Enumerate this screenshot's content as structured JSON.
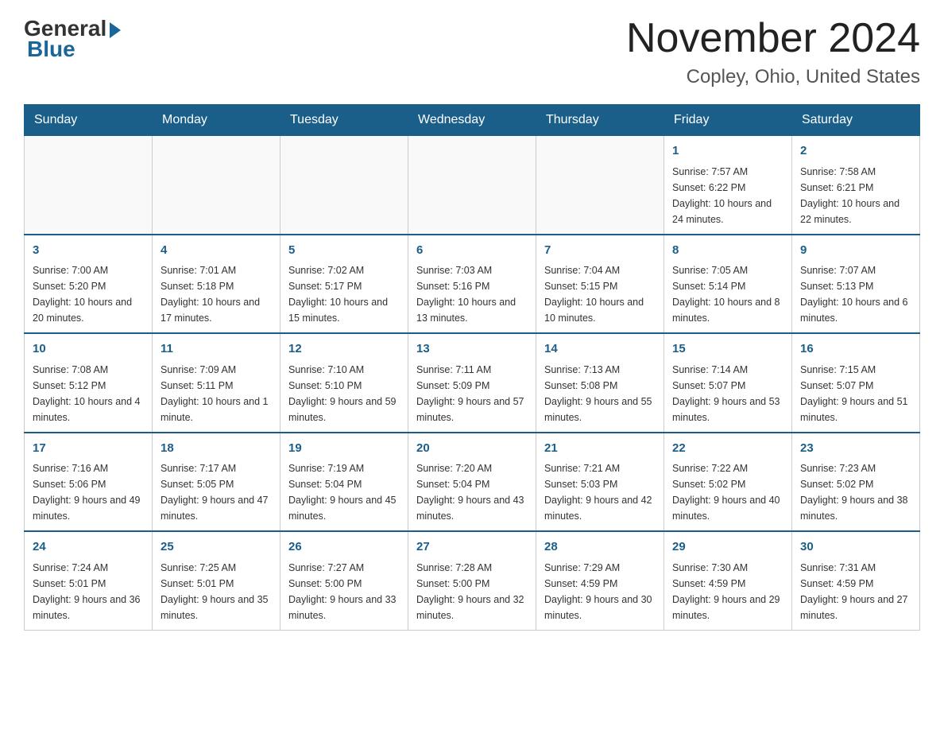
{
  "header": {
    "logo": {
      "general": "General",
      "blue": "Blue"
    },
    "title": "November 2024",
    "subtitle": "Copley, Ohio, United States"
  },
  "days_of_week": [
    "Sunday",
    "Monday",
    "Tuesday",
    "Wednesday",
    "Thursday",
    "Friday",
    "Saturday"
  ],
  "weeks": [
    {
      "cells": [
        {
          "empty": true
        },
        {
          "empty": true
        },
        {
          "empty": true
        },
        {
          "empty": true
        },
        {
          "empty": true
        },
        {
          "day": "1",
          "sunrise": "Sunrise: 7:57 AM",
          "sunset": "Sunset: 6:22 PM",
          "daylight": "Daylight: 10 hours and 24 minutes."
        },
        {
          "day": "2",
          "sunrise": "Sunrise: 7:58 AM",
          "sunset": "Sunset: 6:21 PM",
          "daylight": "Daylight: 10 hours and 22 minutes."
        }
      ]
    },
    {
      "cells": [
        {
          "day": "3",
          "sunrise": "Sunrise: 7:00 AM",
          "sunset": "Sunset: 5:20 PM",
          "daylight": "Daylight: 10 hours and 20 minutes."
        },
        {
          "day": "4",
          "sunrise": "Sunrise: 7:01 AM",
          "sunset": "Sunset: 5:18 PM",
          "daylight": "Daylight: 10 hours and 17 minutes."
        },
        {
          "day": "5",
          "sunrise": "Sunrise: 7:02 AM",
          "sunset": "Sunset: 5:17 PM",
          "daylight": "Daylight: 10 hours and 15 minutes."
        },
        {
          "day": "6",
          "sunrise": "Sunrise: 7:03 AM",
          "sunset": "Sunset: 5:16 PM",
          "daylight": "Daylight: 10 hours and 13 minutes."
        },
        {
          "day": "7",
          "sunrise": "Sunrise: 7:04 AM",
          "sunset": "Sunset: 5:15 PM",
          "daylight": "Daylight: 10 hours and 10 minutes."
        },
        {
          "day": "8",
          "sunrise": "Sunrise: 7:05 AM",
          "sunset": "Sunset: 5:14 PM",
          "daylight": "Daylight: 10 hours and 8 minutes."
        },
        {
          "day": "9",
          "sunrise": "Sunrise: 7:07 AM",
          "sunset": "Sunset: 5:13 PM",
          "daylight": "Daylight: 10 hours and 6 minutes."
        }
      ]
    },
    {
      "cells": [
        {
          "day": "10",
          "sunrise": "Sunrise: 7:08 AM",
          "sunset": "Sunset: 5:12 PM",
          "daylight": "Daylight: 10 hours and 4 minutes."
        },
        {
          "day": "11",
          "sunrise": "Sunrise: 7:09 AM",
          "sunset": "Sunset: 5:11 PM",
          "daylight": "Daylight: 10 hours and 1 minute."
        },
        {
          "day": "12",
          "sunrise": "Sunrise: 7:10 AM",
          "sunset": "Sunset: 5:10 PM",
          "daylight": "Daylight: 9 hours and 59 minutes."
        },
        {
          "day": "13",
          "sunrise": "Sunrise: 7:11 AM",
          "sunset": "Sunset: 5:09 PM",
          "daylight": "Daylight: 9 hours and 57 minutes."
        },
        {
          "day": "14",
          "sunrise": "Sunrise: 7:13 AM",
          "sunset": "Sunset: 5:08 PM",
          "daylight": "Daylight: 9 hours and 55 minutes."
        },
        {
          "day": "15",
          "sunrise": "Sunrise: 7:14 AM",
          "sunset": "Sunset: 5:07 PM",
          "daylight": "Daylight: 9 hours and 53 minutes."
        },
        {
          "day": "16",
          "sunrise": "Sunrise: 7:15 AM",
          "sunset": "Sunset: 5:07 PM",
          "daylight": "Daylight: 9 hours and 51 minutes."
        }
      ]
    },
    {
      "cells": [
        {
          "day": "17",
          "sunrise": "Sunrise: 7:16 AM",
          "sunset": "Sunset: 5:06 PM",
          "daylight": "Daylight: 9 hours and 49 minutes."
        },
        {
          "day": "18",
          "sunrise": "Sunrise: 7:17 AM",
          "sunset": "Sunset: 5:05 PM",
          "daylight": "Daylight: 9 hours and 47 minutes."
        },
        {
          "day": "19",
          "sunrise": "Sunrise: 7:19 AM",
          "sunset": "Sunset: 5:04 PM",
          "daylight": "Daylight: 9 hours and 45 minutes."
        },
        {
          "day": "20",
          "sunrise": "Sunrise: 7:20 AM",
          "sunset": "Sunset: 5:04 PM",
          "daylight": "Daylight: 9 hours and 43 minutes."
        },
        {
          "day": "21",
          "sunrise": "Sunrise: 7:21 AM",
          "sunset": "Sunset: 5:03 PM",
          "daylight": "Daylight: 9 hours and 42 minutes."
        },
        {
          "day": "22",
          "sunrise": "Sunrise: 7:22 AM",
          "sunset": "Sunset: 5:02 PM",
          "daylight": "Daylight: 9 hours and 40 minutes."
        },
        {
          "day": "23",
          "sunrise": "Sunrise: 7:23 AM",
          "sunset": "Sunset: 5:02 PM",
          "daylight": "Daylight: 9 hours and 38 minutes."
        }
      ]
    },
    {
      "cells": [
        {
          "day": "24",
          "sunrise": "Sunrise: 7:24 AM",
          "sunset": "Sunset: 5:01 PM",
          "daylight": "Daylight: 9 hours and 36 minutes."
        },
        {
          "day": "25",
          "sunrise": "Sunrise: 7:25 AM",
          "sunset": "Sunset: 5:01 PM",
          "daylight": "Daylight: 9 hours and 35 minutes."
        },
        {
          "day": "26",
          "sunrise": "Sunrise: 7:27 AM",
          "sunset": "Sunset: 5:00 PM",
          "daylight": "Daylight: 9 hours and 33 minutes."
        },
        {
          "day": "27",
          "sunrise": "Sunrise: 7:28 AM",
          "sunset": "Sunset: 5:00 PM",
          "daylight": "Daylight: 9 hours and 32 minutes."
        },
        {
          "day": "28",
          "sunrise": "Sunrise: 7:29 AM",
          "sunset": "Sunset: 4:59 PM",
          "daylight": "Daylight: 9 hours and 30 minutes."
        },
        {
          "day": "29",
          "sunrise": "Sunrise: 7:30 AM",
          "sunset": "Sunset: 4:59 PM",
          "daylight": "Daylight: 9 hours and 29 minutes."
        },
        {
          "day": "30",
          "sunrise": "Sunrise: 7:31 AM",
          "sunset": "Sunset: 4:59 PM",
          "daylight": "Daylight: 9 hours and 27 minutes."
        }
      ]
    }
  ]
}
